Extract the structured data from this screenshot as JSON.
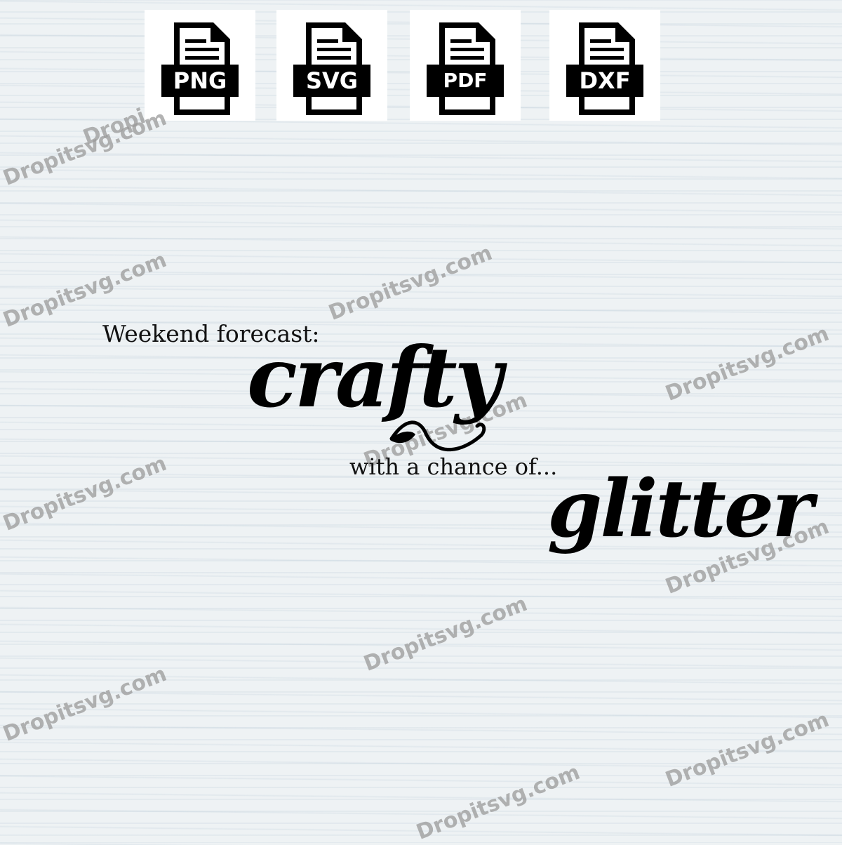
{
  "formats": [
    {
      "label": "PNG",
      "icon": "file-icon"
    },
    {
      "label": "SVG",
      "icon": "file-icon"
    },
    {
      "label": "PDF",
      "icon": "file-icon"
    },
    {
      "label": "DXF",
      "icon": "file-icon"
    }
  ],
  "quote": {
    "line1": "Weekend forecast:",
    "word1": "crafty",
    "line2": "with a chance of...",
    "word2": "glitter"
  },
  "watermark": "Dropitsvg.com",
  "colors": {
    "background": "#eef2f4",
    "ink": "#000000",
    "watermark": "#9a9a9a"
  }
}
